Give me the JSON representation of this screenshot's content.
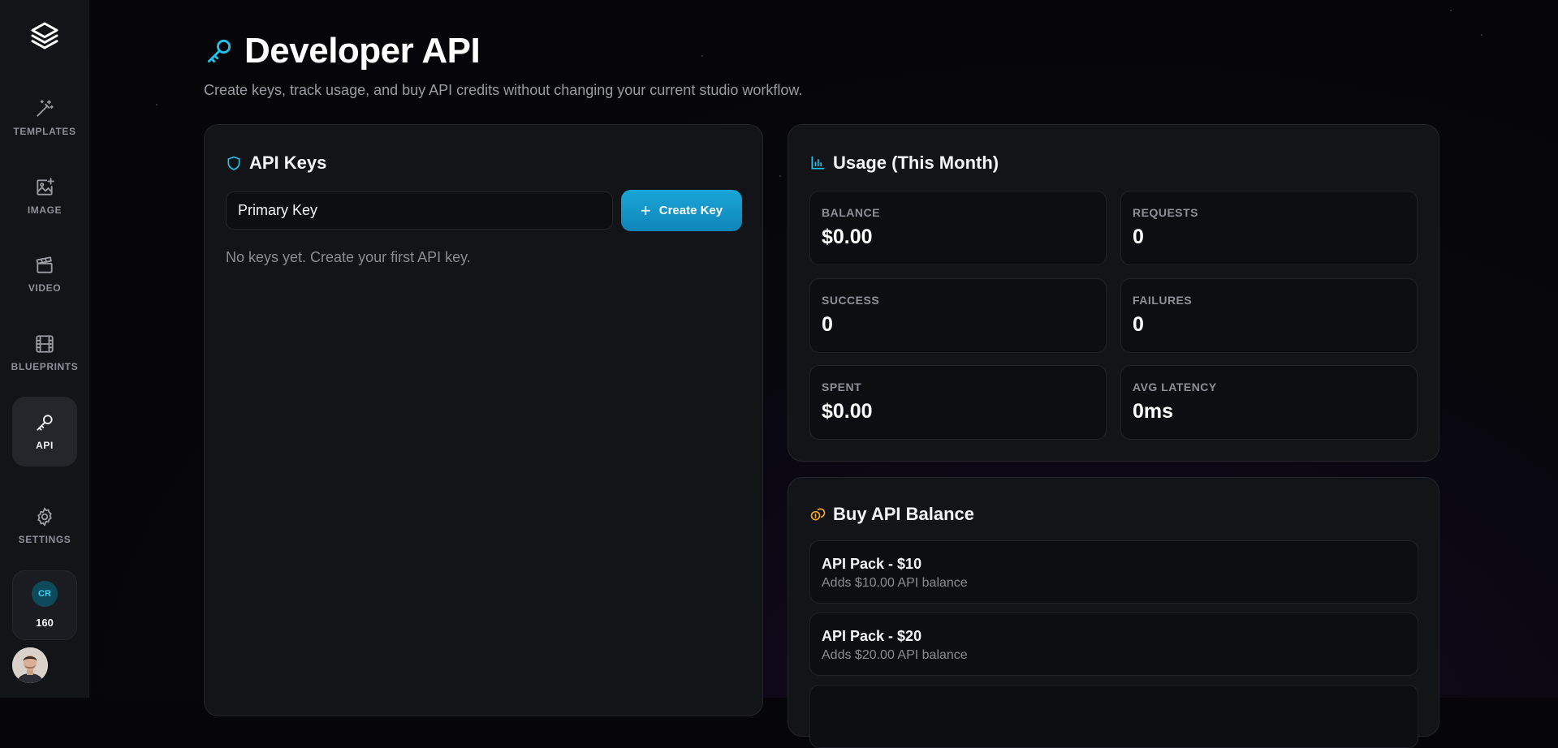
{
  "sidebar": {
    "items": [
      {
        "label": "TEMPLATES",
        "icon": "magic-wand-icon"
      },
      {
        "label": "IMAGE",
        "icon": "image-plus-icon"
      },
      {
        "label": "VIDEO",
        "icon": "clapperboard-icon"
      },
      {
        "label": "BLUEPRINTS",
        "icon": "film-icon"
      },
      {
        "label": "API",
        "icon": "key-icon"
      },
      {
        "label": "SETTINGS",
        "icon": "gear-icon"
      }
    ],
    "credits": {
      "badge": "CR",
      "count": "160"
    }
  },
  "header": {
    "title": "Developer API",
    "subtitle": "Create keys, track usage, and buy API credits without changing your current studio workflow."
  },
  "api_keys": {
    "title": "API Keys",
    "input_value": "Primary Key",
    "create_label": "Create Key",
    "empty_text": "No keys yet. Create your first API key."
  },
  "usage": {
    "title": "Usage (This Month)",
    "stats": [
      {
        "label": "BALANCE",
        "value": "$0.00"
      },
      {
        "label": "REQUESTS",
        "value": "0"
      },
      {
        "label": "SUCCESS",
        "value": "0"
      },
      {
        "label": "FAILURES",
        "value": "0"
      },
      {
        "label": "SPENT",
        "value": "$0.00"
      },
      {
        "label": "AVG LATENCY",
        "value": "0ms"
      }
    ]
  },
  "buy": {
    "title": "Buy API Balance",
    "packs": [
      {
        "name": "API Pack - $10",
        "desc": "Adds $10.00 API balance"
      },
      {
        "name": "API Pack - $20",
        "desc": "Adds $20.00 API balance"
      }
    ]
  },
  "colors": {
    "accent": "#1aa6d8",
    "coin": "#f5a524",
    "background": "#07070c"
  }
}
